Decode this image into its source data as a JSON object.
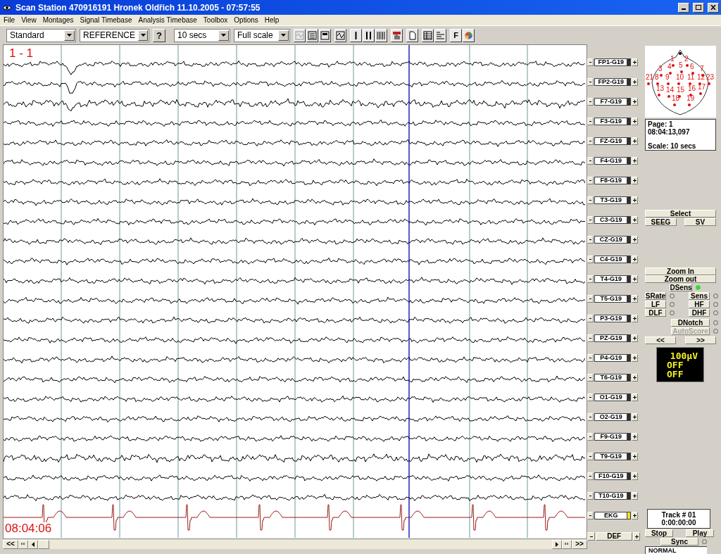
{
  "window": {
    "title": "Scan Station 470916191 Hronek Oldřich 11.10.2005 - 07:57:55"
  },
  "menu": [
    "File",
    "View",
    "Montages",
    "Signal Timebase",
    "Analysis Timebase",
    "Toolbox",
    "Options",
    "Help"
  ],
  "toolbar": {
    "montage": "Standard",
    "reference": "REFERENCE",
    "help": "?",
    "timebase": "10 secs",
    "scale": "Full scale",
    "font": "F"
  },
  "chart": {
    "page_label": "1 - 1",
    "time_label": "08:04:06"
  },
  "channels": [
    {
      "label": "FP1-G19",
      "kind": "eeg"
    },
    {
      "label": "FP2-G19",
      "kind": "eeg"
    },
    {
      "label": "F7-G19",
      "kind": "eeg"
    },
    {
      "label": "F3-G19",
      "kind": "eeg"
    },
    {
      "label": "FZ-G19",
      "kind": "eeg"
    },
    {
      "label": "F4-G19",
      "kind": "eeg"
    },
    {
      "label": "F8-G19",
      "kind": "eeg"
    },
    {
      "label": "T3-G19",
      "kind": "eeg"
    },
    {
      "label": "C3-G19",
      "kind": "eeg"
    },
    {
      "label": "CZ-G19",
      "kind": "eeg"
    },
    {
      "label": "C4-G19",
      "kind": "eeg"
    },
    {
      "label": "T4-G19",
      "kind": "eeg"
    },
    {
      "label": "T5-G19",
      "kind": "eeg"
    },
    {
      "label": "P3-G19",
      "kind": "eeg"
    },
    {
      "label": "PZ-G19",
      "kind": "eeg"
    },
    {
      "label": "P4-G19",
      "kind": "eeg"
    },
    {
      "label": "T6-G19",
      "kind": "eeg"
    },
    {
      "label": "O1-G19",
      "kind": "eeg"
    },
    {
      "label": "O2-G19",
      "kind": "eeg"
    },
    {
      "label": "F9-G19",
      "kind": "eeg"
    },
    {
      "label": "T9-G19",
      "kind": "eeg"
    },
    {
      "label": "F10-G19",
      "kind": "eeg"
    },
    {
      "label": "T10-G19",
      "kind": "eeg"
    },
    {
      "label": "EKG",
      "kind": "ekg"
    }
  ],
  "scroll": {
    "back": "<<",
    "forward": ">>"
  },
  "def_button": "DEF",
  "electrodes": [
    "1",
    "2",
    "3",
    "4",
    "5",
    "6",
    "7",
    "21",
    "8",
    "9",
    "10",
    "11",
    "12",
    "23",
    "13",
    "14",
    "15",
    "16",
    "17",
    "18",
    "19"
  ],
  "info": {
    "page": "Page: 1",
    "time": "08:04:13,097",
    "scale": "Scale: 10 secs"
  },
  "select": "Select",
  "mode_buttons": [
    "SEEG",
    "SV"
  ],
  "zoom_buttons": [
    "Zoom In",
    "Zoom out"
  ],
  "toggles": [
    {
      "label": "DSens",
      "on": true,
      "disabled": false
    },
    {
      "label": "SRate",
      "on": false,
      "disabled": false
    },
    {
      "label": "Sens",
      "on": false,
      "disabled": false
    },
    {
      "label": "LF",
      "on": false,
      "disabled": false
    },
    {
      "label": "HF",
      "on": false,
      "disabled": false
    },
    {
      "label": "DLF",
      "on": false,
      "disabled": false
    },
    {
      "label": "DHF",
      "on": false,
      "disabled": false
    },
    {
      "label": "DNotch",
      "on": false,
      "disabled": false
    },
    {
      "label": "AutoScore",
      "on": false,
      "disabled": true
    }
  ],
  "page_buttons": [
    "<<",
    ">>"
  ],
  "display": [
    "100µV",
    "OFF",
    "OFF"
  ],
  "track": {
    "name": "Track # 01",
    "time": "0:00:00:00"
  },
  "playback": [
    "Stop",
    "Play"
  ],
  "sync": {
    "label": "Sync",
    "on": false
  },
  "mode_select": "NORMAL"
}
